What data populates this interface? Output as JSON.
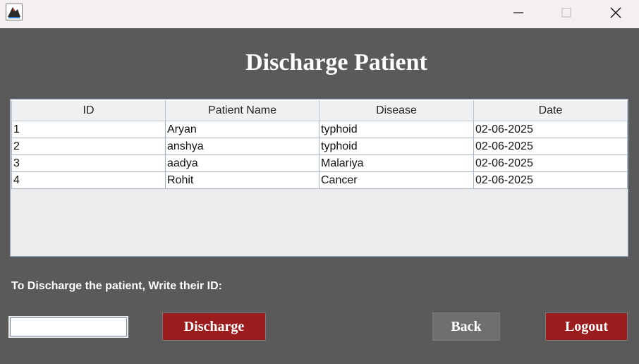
{
  "window": {
    "icons": {
      "app": "java-app-icon",
      "minimize": "minimize-icon",
      "maximize": "maximize-icon",
      "close": "close-icon"
    }
  },
  "page": {
    "title": "Discharge Patient",
    "instruction": "To Discharge the patient, Write their ID:",
    "id_input": {
      "value": "",
      "placeholder": ""
    }
  },
  "table": {
    "columns": [
      "ID",
      "Patient Name",
      "Disease",
      "Date"
    ],
    "rows": [
      [
        "1",
        "Aryan",
        "typhoid",
        "02-06-2025"
      ],
      [
        "2",
        "anshya",
        "typhoid",
        "02-06-2025"
      ],
      [
        "3",
        "aadya",
        "Malariya",
        "02-06-2025"
      ],
      [
        "4",
        "Rohit",
        "Cancer",
        "02-06-2025"
      ]
    ]
  },
  "buttons": {
    "discharge": "Discharge",
    "back": "Back",
    "logout": "Logout"
  },
  "colors": {
    "background": "#5a5a5a",
    "accent_button": "#9b1c1c",
    "back_button": "#6f6f6f"
  }
}
